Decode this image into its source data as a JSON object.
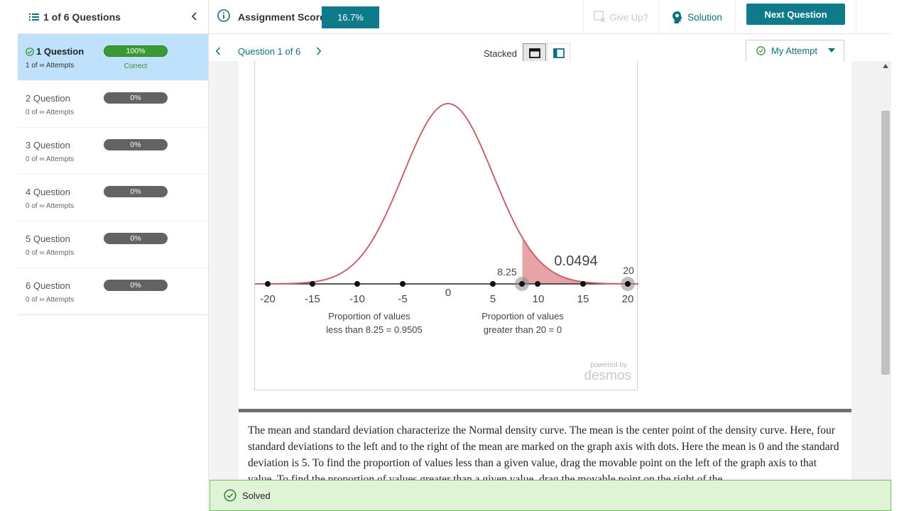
{
  "sidebar": {
    "title": "1 of 6 Questions",
    "items": [
      {
        "name": "1 Question",
        "attempts": "1 of ∞ Attempts",
        "progress": "100%",
        "status": "Correct"
      },
      {
        "name": "2 Question",
        "attempts": "0 of ∞ Attempts",
        "progress": "0%"
      },
      {
        "name": "3 Question",
        "attempts": "0 of ∞ Attempts",
        "progress": "0%"
      },
      {
        "name": "4 Question",
        "attempts": "0 of ∞ Attempts",
        "progress": "0%"
      },
      {
        "name": "5 Question",
        "attempts": "0 of ∞ Attempts",
        "progress": "0%"
      },
      {
        "name": "6 Question",
        "attempts": "0 of ∞ Attempts",
        "progress": "0%"
      }
    ]
  },
  "topbar": {
    "score_label": "Assignment Score:",
    "score_value": "16.7%",
    "give_up": "Give Up?",
    "solution": "Solution",
    "next_question": "Next Question"
  },
  "subhead": {
    "question_nav": "Question 1 of 6",
    "view_label": "Stacked",
    "attempt_dropdown": "My Attempt"
  },
  "graph": {
    "axis_ticks": [
      "-20",
      "-15",
      "-10",
      "-5",
      "0",
      "5",
      "10",
      "15",
      "20"
    ],
    "left_point_value": "8.25",
    "right_point_value": "20",
    "shaded_area": "0.0494",
    "left_caption_line1": "Proportion of values",
    "left_caption_line2": "less than 8.25 = 0.9505",
    "right_caption_line1": "Proportion of values",
    "right_caption_line2": "greater than 20 = 0",
    "powered_by": "powered by",
    "brand": "desmos",
    "mean": 0,
    "sd": 5,
    "colors": {
      "curve": "#c8646d",
      "shade": "#e8a3a8",
      "accent": "#0e7a8a"
    }
  },
  "description": "The mean and standard deviation characterize the Normal density curve. The mean is the center point of the density curve. Here, four standard deviations to the left and to the right of the mean are marked on the graph axis with dots. Here the mean is 0 and the standard deviation is 5. To find the proportion of values less than a given value, drag the movable point on the left of the graph axis to that value. To find the proportion of values greater than a given value, drag the movable point on the right of the",
  "toast": {
    "label": "Solved"
  }
}
